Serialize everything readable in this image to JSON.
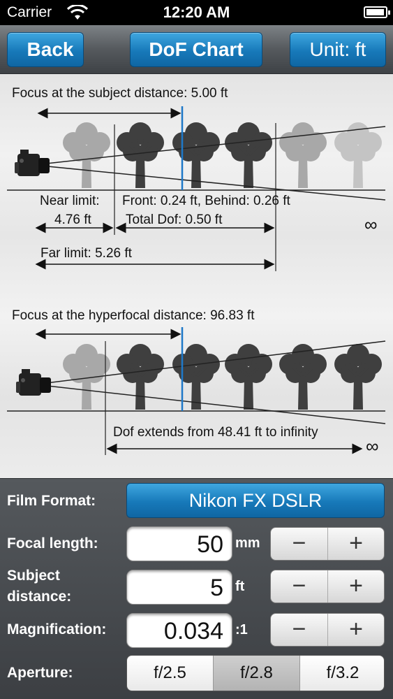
{
  "status_bar": {
    "carrier": "Carrier",
    "time": "12:20 AM",
    "battery_level": 0.95
  },
  "nav": {
    "back_label": "Back",
    "title": "DoF Chart",
    "unit_label": "Unit: ft"
  },
  "chart": {
    "subject_panel": {
      "heading": "Focus at the subject distance: 5.00 ft",
      "near_limit_label": "Near limit:",
      "near_limit_value": "4.76 ft",
      "front_behind": "Front: 0.24 ft, Behind: 0.26 ft",
      "total_dof": "Total Dof: 0.50 ft",
      "far_limit": "Far limit: 5.26 ft",
      "infinity": "∞"
    },
    "hyperfocal_panel": {
      "heading": "Focus at the hyperfocal distance: 96.83 ft",
      "extent": "Dof extends from 48.41 ft to infinity",
      "infinity": "∞"
    },
    "colors": {
      "focus_line": "#1e78c8",
      "tree_sharp": "#3f3f3f",
      "tree_blurred": "#a8a8a8"
    }
  },
  "controls": {
    "film_format_label": "Film Format:",
    "film_format_value": "Nikon FX DSLR",
    "focal_length_label": "Focal length:",
    "focal_length_value": "50",
    "focal_length_unit": "mm",
    "subject_distance_label_line1": "Subject",
    "subject_distance_label_line2": "distance:",
    "subject_distance_value": "5",
    "subject_distance_unit": "ft",
    "magnification_label": "Magnification:",
    "magnification_value": "0.034",
    "magnification_unit": ":1",
    "stepper_minus": "−",
    "stepper_plus": "+",
    "aperture_label": "Aperture:",
    "aperture_options": [
      "f/2.5",
      "f/2.8",
      "f/3.2"
    ],
    "aperture_selected": "f/2.8"
  }
}
